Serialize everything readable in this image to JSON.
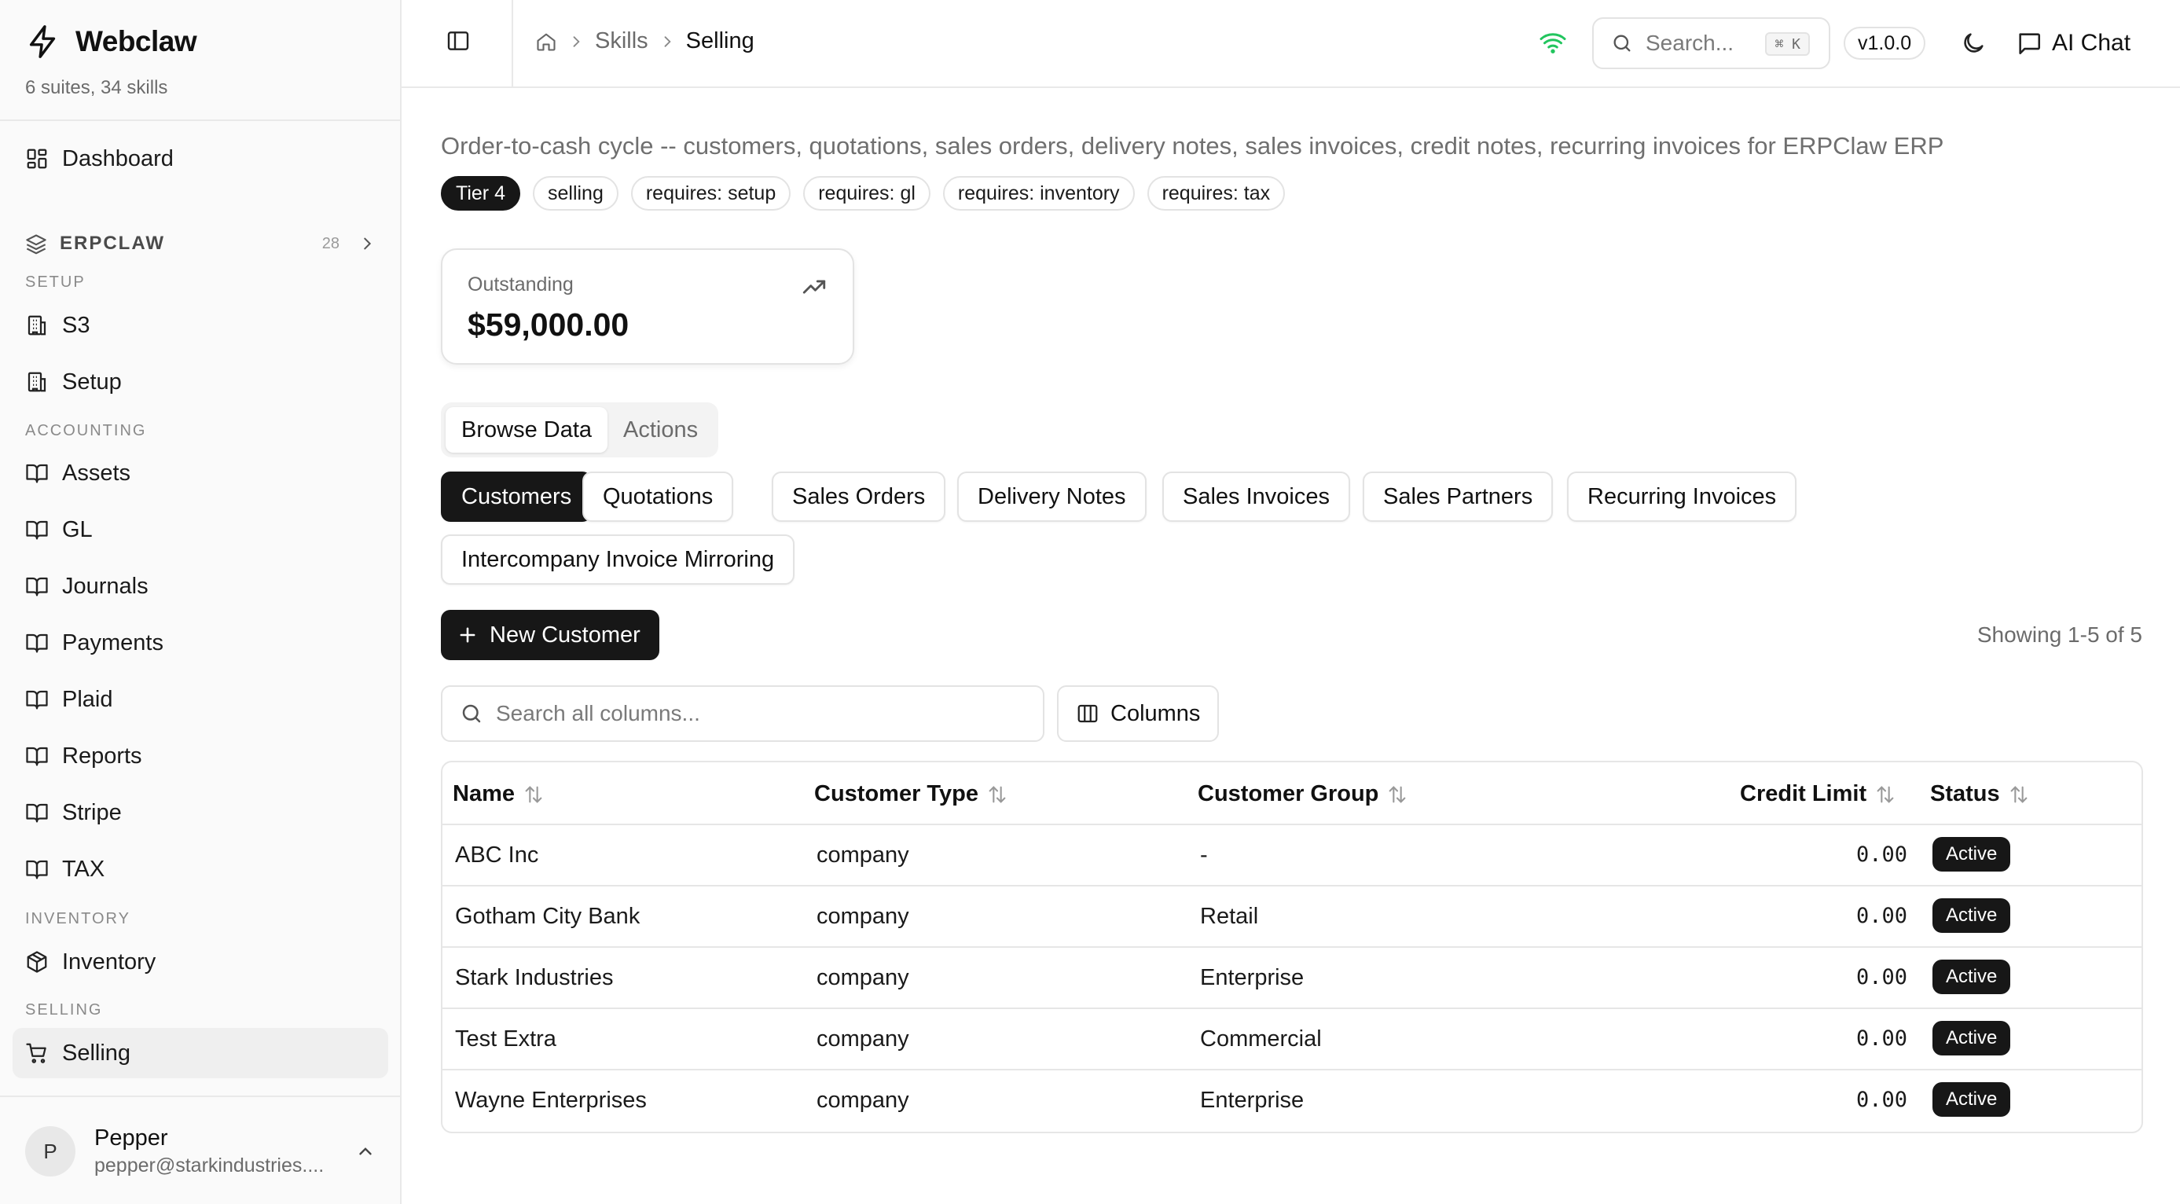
{
  "brand": {
    "name": "Webclaw",
    "subtitle": "6 suites, 34 skills"
  },
  "sidebar": {
    "dashboard": {
      "label": "Dashboard",
      "icon": "dashboard-icon"
    },
    "group": {
      "name": "ERPCLAW",
      "count": "28"
    },
    "sections": {
      "setup": "SETUP",
      "accounting": "ACCOUNTING",
      "inventory": "INVENTORY",
      "selling": "SELLING"
    },
    "items": {
      "s3": "S3",
      "setup": "Setup",
      "assets": "Assets",
      "gl": "GL",
      "journals": "Journals",
      "payments": "Payments",
      "plaid": "Plaid",
      "reports": "Reports",
      "stripe": "Stripe",
      "tax": "TAX",
      "inventory": "Inventory",
      "selling": "Selling"
    },
    "user": {
      "initial": "P",
      "name": "Pepper",
      "email": "pepper@starkindustries...."
    }
  },
  "header": {
    "breadcrumb": [
      "Skills",
      "Selling"
    ],
    "search_placeholder": "Search...",
    "shortcut": "⌘ K",
    "version": "v1.0.0",
    "ai_chat": "AI Chat",
    "status_color": "#22c55e"
  },
  "page": {
    "description": "Order-to-cash cycle -- customers, quotations, sales orders, delivery notes, sales invoices, credit notes, recurring invoices for ERPClaw ERP",
    "tags": [
      "Tier 4",
      "selling",
      "requires: setup",
      "requires: gl",
      "requires: inventory",
      "requires: tax"
    ]
  },
  "stat": {
    "label": "Outstanding",
    "value": "$59,000.00"
  },
  "view_tabs": [
    "Browse Data",
    "Actions"
  ],
  "entity_tabs": [
    "Customers",
    "Quotations",
    "Sales Orders",
    "Delivery Notes",
    "Sales Invoices",
    "Sales Partners",
    "Recurring Invoices",
    "Intercompany Invoice Mirroring"
  ],
  "toolbar": {
    "new_label": "New Customer",
    "showing": "Showing 1-5 of 5",
    "search_placeholder": "Search all columns...",
    "columns_label": "Columns"
  },
  "table": {
    "headers": [
      "Name",
      "Customer Type",
      "Customer Group",
      "Credit Limit",
      "Status"
    ],
    "rows": [
      {
        "name": "ABC Inc",
        "type": "company",
        "group": "-",
        "credit": "0.00",
        "status": "Active"
      },
      {
        "name": "Gotham City Bank",
        "type": "company",
        "group": "Retail",
        "credit": "0.00",
        "status": "Active"
      },
      {
        "name": "Stark Industries",
        "type": "company",
        "group": "Enterprise",
        "credit": "0.00",
        "status": "Active"
      },
      {
        "name": "Test Extra",
        "type": "company",
        "group": "Commercial",
        "credit": "0.00",
        "status": "Active"
      },
      {
        "name": "Wayne Enterprises",
        "type": "company",
        "group": "Enterprise",
        "credit": "0.00",
        "status": "Active"
      }
    ]
  }
}
